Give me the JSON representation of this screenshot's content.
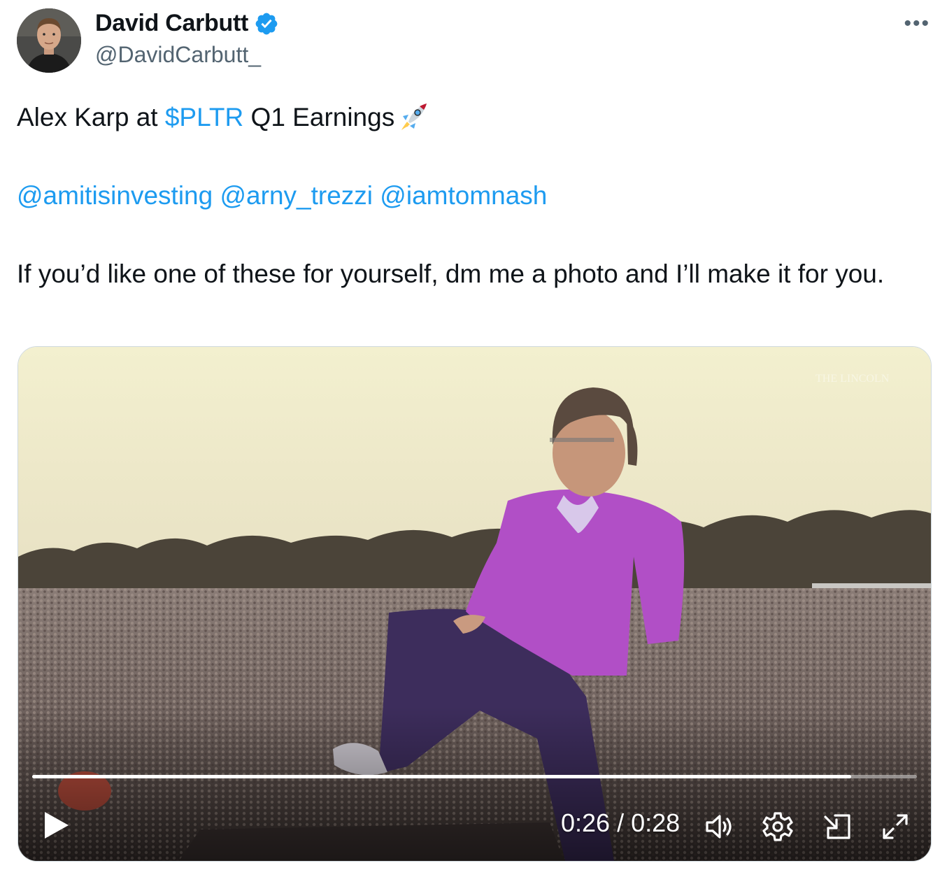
{
  "author": {
    "name": "David Carbutt",
    "handle": "@DavidCarbutt_",
    "verified": true,
    "badge_color": "#1d9bf0"
  },
  "menu": {
    "more_label": "•••"
  },
  "tweet": {
    "line1_prefix": "Alex Karp at ",
    "cashtag": "$PLTR",
    "line1_suffix": " Q1 Earnings",
    "emoji": "rocket",
    "mentions": [
      "@amitisinvesting",
      "@arny_trezzi",
      "@iamtomnash"
    ],
    "body": "If you’d like one of these for yourself, dm me a photo and I’ll make it for you."
  },
  "video": {
    "current_time": "0:26",
    "duration": "0:28",
    "time_label": "0:26 / 0:28",
    "progress_fraction": 0.926,
    "controls": [
      "play-icon",
      "volume-icon",
      "settings-icon",
      "pop-out-icon",
      "fullscreen-icon"
    ]
  },
  "colors": {
    "link": "#1d9bf0",
    "text": "#0f1419",
    "secondary": "#536471"
  }
}
